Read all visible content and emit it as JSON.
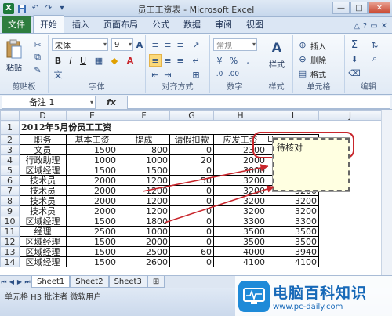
{
  "window": {
    "title": "员工工资表 - Microsoft Excel",
    "minimize": "—",
    "maximize": "□",
    "close": "✕"
  },
  "ribbon_tabs": [
    {
      "label": "文件"
    },
    {
      "label": "开始"
    },
    {
      "label": "插入"
    },
    {
      "label": "页面布局"
    },
    {
      "label": "公式"
    },
    {
      "label": "数据"
    },
    {
      "label": "审阅"
    },
    {
      "label": "视图"
    }
  ],
  "ribbon": {
    "clipboard": {
      "paste": "粘贴",
      "label": "剪贴板"
    },
    "font": {
      "name": "宋体",
      "size": "9",
      "bold": "B",
      "italic": "I",
      "underline": "U",
      "label": "字体",
      "grow": "A",
      "shrink": "A"
    },
    "alignment": {
      "label": "对齐方式"
    },
    "number": {
      "format": "常规",
      "label": "数字"
    },
    "styles": {
      "label": "样式",
      "button": "样式"
    },
    "cells": {
      "insert": "插入",
      "delete": "删除",
      "format": "格式",
      "label": "单元格"
    },
    "editing": {
      "label": "编辑",
      "sum": "Σ"
    }
  },
  "formula_bar": {
    "name_box": "备注 1",
    "fx": "fx",
    "value": ""
  },
  "columns": [
    "D",
    "E",
    "F",
    "G",
    "H",
    "I",
    "J"
  ],
  "sheet_title": "2012年5月份员工工资",
  "headers": [
    "职务",
    "基本工资",
    "提成",
    "请假扣款",
    "应发工资"
  ],
  "rows": [
    {
      "n": "3",
      "job": "文员",
      "base": "1500",
      "bonus": "800",
      "deduct": "0",
      "pay": "2300",
      "i": ""
    },
    {
      "n": "4",
      "job": "行政助理",
      "base": "1000",
      "bonus": "1000",
      "deduct": "20",
      "pay": "2000",
      "i": ""
    },
    {
      "n": "5",
      "job": "区域经理",
      "base": "1500",
      "bonus": "1500",
      "deduct": "0",
      "pay": "3000",
      "i": ""
    },
    {
      "n": "6",
      "job": "技术员",
      "base": "2000",
      "bonus": "1200",
      "deduct": "50",
      "pay": "3200",
      "i": ""
    },
    {
      "n": "7",
      "job": "技术员",
      "base": "2000",
      "bonus": "1200",
      "deduct": "0",
      "pay": "3200",
      "i": "3200"
    },
    {
      "n": "8",
      "job": "技术员",
      "base": "2000",
      "bonus": "1200",
      "deduct": "0",
      "pay": "3200",
      "i": "3200"
    },
    {
      "n": "9",
      "job": "技术员",
      "base": "2000",
      "bonus": "1200",
      "deduct": "0",
      "pay": "3200",
      "i": "3200"
    },
    {
      "n": "10",
      "job": "区域经理",
      "base": "1500",
      "bonus": "1800",
      "deduct": "0",
      "pay": "3300",
      "i": "3300"
    },
    {
      "n": "11",
      "job": "经理",
      "base": "2500",
      "bonus": "1000",
      "deduct": "0",
      "pay": "3500",
      "i": "3500"
    },
    {
      "n": "12",
      "job": "区域经理",
      "base": "1500",
      "bonus": "2000",
      "deduct": "0",
      "pay": "3500",
      "i": "3500"
    },
    {
      "n": "13",
      "job": "区域经理",
      "base": "1500",
      "bonus": "2500",
      "deduct": "60",
      "pay": "4000",
      "i": "3940"
    },
    {
      "n": "14",
      "job": "区域经理",
      "base": "1500",
      "bonus": "2600",
      "deduct": "0",
      "pay": "4100",
      "i": "4100"
    }
  ],
  "comment": {
    "text": "待核对"
  },
  "sheet_tabs": [
    {
      "label": "Sheet1"
    },
    {
      "label": "Sheet2"
    },
    {
      "label": "Sheet3"
    }
  ],
  "status_bar": {
    "text": "单元格 H3 批注者 微软用户"
  },
  "watermark": {
    "cn": "电脑百科知识",
    "url": "www.pc-daily.com"
  },
  "colors": {
    "file_tab": "#2e7d3f",
    "accent_red": "#c8262c",
    "comment_bg": "#ffffe1",
    "watermark": "#1769b8"
  }
}
